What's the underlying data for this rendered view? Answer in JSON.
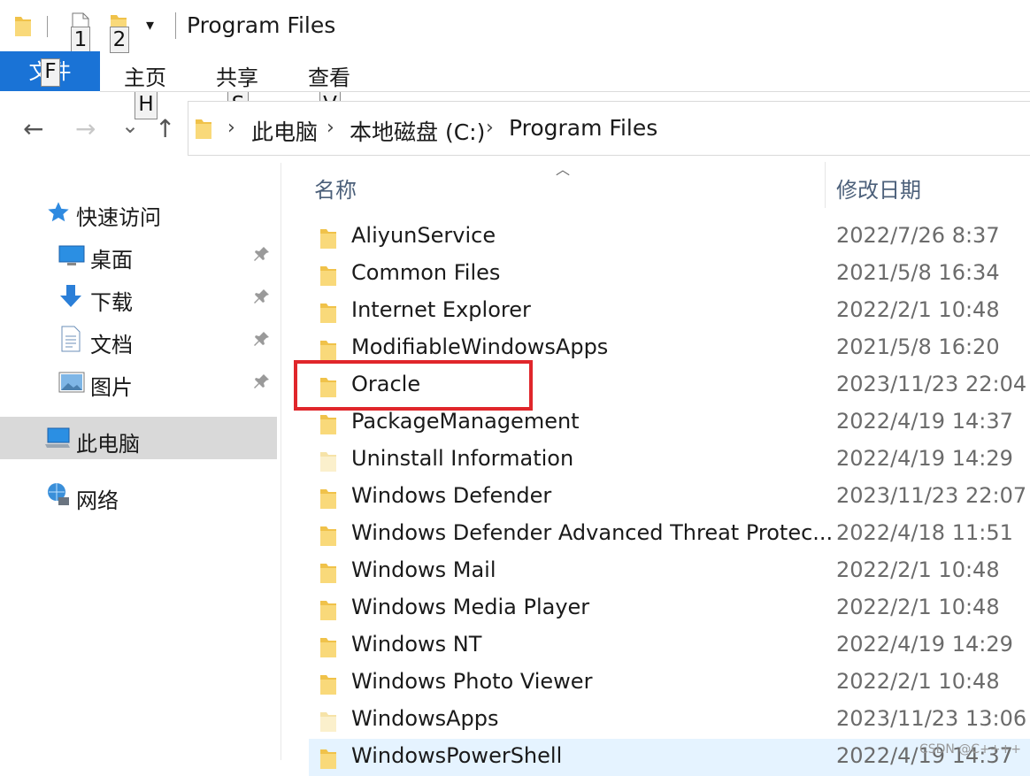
{
  "window": {
    "title": "Program Files"
  },
  "quick_access_toolbar": {
    "key_tips": [
      "1",
      "2"
    ],
    "dropdown_glyph": "▾"
  },
  "ribbon": {
    "tabs": [
      {
        "label": "文件",
        "key_tip": "F"
      },
      {
        "label": "主页",
        "key_tip": "H"
      },
      {
        "label": "共享",
        "key_tip": "S"
      },
      {
        "label": "查看",
        "key_tip": "V"
      }
    ]
  },
  "navigation": {
    "back_glyph": "←",
    "forward_glyph": "→",
    "recent_glyph": "⌄",
    "up_glyph": "↑",
    "breadcrumb": [
      "此电脑",
      "本地磁盘 (C:)",
      "Program Files"
    ]
  },
  "sidebar": {
    "quick_access": "快速访问",
    "items": [
      {
        "label": "桌面",
        "icon": "desktop-icon",
        "pinned": true
      },
      {
        "label": "下载",
        "icon": "download-icon",
        "pinned": true
      },
      {
        "label": "文档",
        "icon": "document-icon",
        "pinned": true
      },
      {
        "label": "图片",
        "icon": "pictures-icon",
        "pinned": true
      }
    ],
    "this_pc": "此电脑",
    "network": "网络",
    "pin_glyph": "📌"
  },
  "file_list": {
    "columns": {
      "name": "名称",
      "date": "修改日期"
    },
    "rows": [
      {
        "name": "AliyunService",
        "date": "2022/7/26 8:37"
      },
      {
        "name": "Common Files",
        "date": "2021/5/8 16:34"
      },
      {
        "name": "Internet Explorer",
        "date": "2022/2/1 10:48"
      },
      {
        "name": "ModifiableWindowsApps",
        "date": "2021/5/8 16:20"
      },
      {
        "name": "Oracle",
        "date": "2023/11/23 22:04"
      },
      {
        "name": "PackageManagement",
        "date": "2022/4/19 14:37"
      },
      {
        "name": "Uninstall Information",
        "date": "2022/4/19 14:29"
      },
      {
        "name": "Windows Defender",
        "date": "2023/11/23 22:07"
      },
      {
        "name": "Windows Defender Advanced Threat Protec...",
        "date": "2022/4/18 11:51"
      },
      {
        "name": "Windows Mail",
        "date": "2022/2/1 10:48"
      },
      {
        "name": "Windows Media Player",
        "date": "2022/2/1 10:48"
      },
      {
        "name": "Windows NT",
        "date": "2022/4/19 14:29"
      },
      {
        "name": "Windows Photo Viewer",
        "date": "2022/2/1 10:48"
      },
      {
        "name": "WindowsApps",
        "date": "2023/11/23 13:06"
      },
      {
        "name": "WindowsPowerShell",
        "date": "2022/4/19 14:37"
      }
    ]
  },
  "watermark": "CSDN @C++++",
  "colors": {
    "accent": "#1a73d6",
    "highlight": "#e0262b",
    "folder": "#f7c948"
  }
}
